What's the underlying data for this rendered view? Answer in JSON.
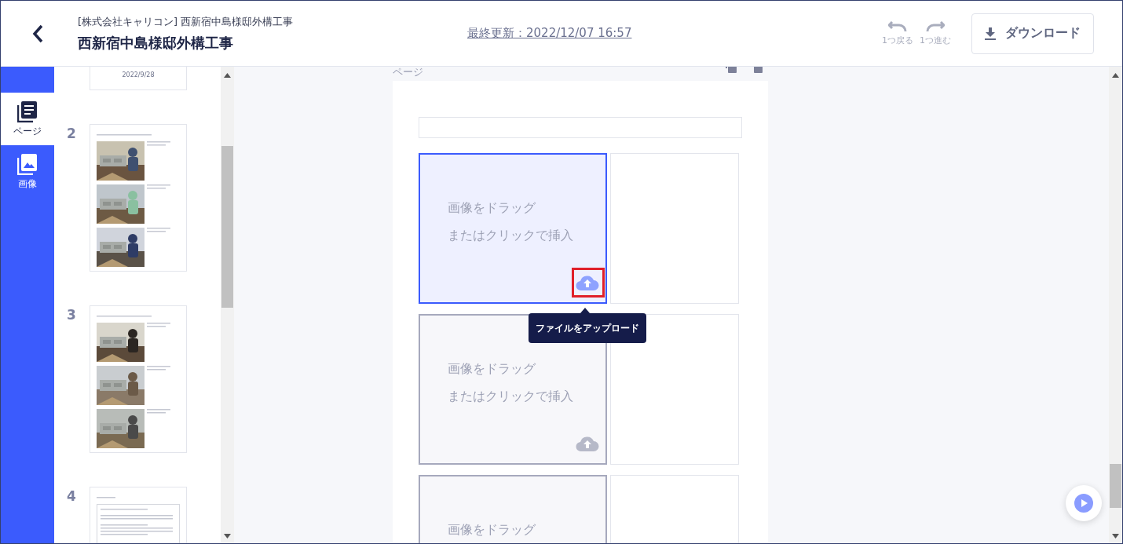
{
  "header": {
    "subtitle": "[株式会社キャリコン] 西新宿中島様邸外構工事",
    "title": "西新宿中島様邸外構工事",
    "last_updated": "最終更新：2022/12/07 16:57",
    "history": [
      {
        "kind": "undo",
        "label": "1つ戻る",
        "disabled": true
      },
      {
        "kind": "redo",
        "label": "1つ進む",
        "disabled": true
      }
    ],
    "download": "ダウンロード"
  },
  "rail": [
    {
      "kind": "pages",
      "label": "ページ",
      "selected": true
    },
    {
      "kind": "images",
      "label": "画像",
      "selected": false
    }
  ],
  "thumbnails": [
    {
      "kind": "cover",
      "date": "2022/9/28"
    },
    {
      "kind": "photos",
      "number": "2"
    },
    {
      "kind": "photos",
      "number": "3"
    },
    {
      "kind": "text",
      "number": "4"
    }
  ],
  "editor": {
    "page_label": "ページ",
    "slots": [
      {
        "lines": [
          "画像をドラッグ",
          "またはクリックで挿入"
        ],
        "selected": true
      },
      {
        "lines": [
          "画像をドラッグ",
          "またはクリックで挿入"
        ],
        "selected": false
      },
      {
        "lines": [
          "画像をドラッグ"
        ],
        "selected": false
      }
    ],
    "tooltip": "ファイルをアップロード"
  }
}
